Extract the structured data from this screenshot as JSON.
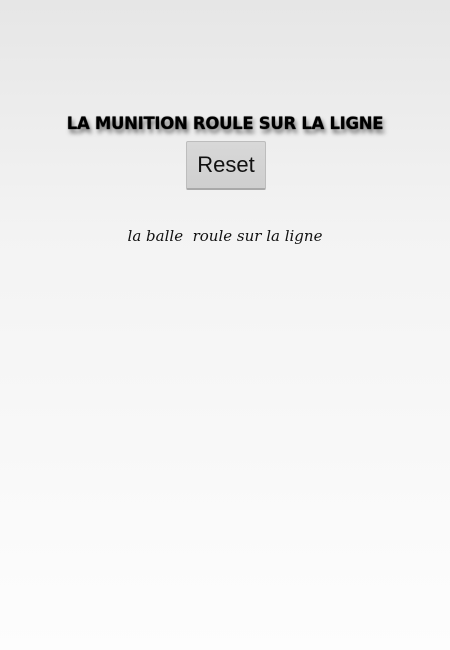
{
  "main": {
    "title": "LA MUNITION ROULE SUR LA LIGNE",
    "reset_label": "Reset",
    "status_text": "la balle  roule sur la ligne"
  },
  "colors": {
    "background_top": "#e6e6e6",
    "background_bottom": "#fdfdfd",
    "button_face": "#d4d4d4",
    "text": "#000000"
  }
}
